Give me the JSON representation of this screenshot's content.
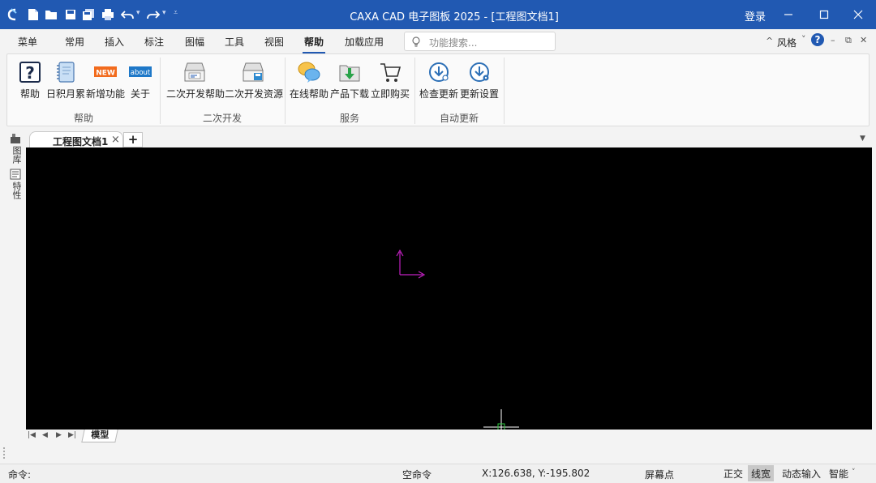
{
  "window": {
    "title": "CAXA CAD 电子图板 2025 - [工程图文档1]",
    "login_label": "登录",
    "accent_color": "#2159b2"
  },
  "quick_access": {
    "icons": [
      "new-file-icon",
      "open-file-icon",
      "save-icon",
      "save-all-icon",
      "print-icon",
      "undo-icon",
      "redo-icon",
      "customize-icon"
    ]
  },
  "menu_tabs": [
    {
      "label": "菜单"
    },
    {
      "label": "常用"
    },
    {
      "label": "插入"
    },
    {
      "label": "标注"
    },
    {
      "label": "图幅"
    },
    {
      "label": "工具"
    },
    {
      "label": "视图"
    },
    {
      "label": "帮助",
      "active": true
    },
    {
      "label": "加载应用"
    }
  ],
  "search": {
    "placeholder": "功能搜索..."
  },
  "style_switch": {
    "label": "风格"
  },
  "ribbon": {
    "groups": [
      {
        "label": "帮助",
        "buttons": [
          {
            "label": "帮助",
            "icon": "help-question-icon"
          },
          {
            "label": "日积月累",
            "icon": "notebook-icon"
          },
          {
            "label": "新增功能",
            "icon": "new-badge-icon",
            "badge": "NEW"
          },
          {
            "label": "关于",
            "icon": "about-badge-icon",
            "badge": "about"
          }
        ]
      },
      {
        "label": "二次开发",
        "buttons": [
          {
            "label": "二次开发帮助",
            "icon": "dev-help-icon"
          },
          {
            "label": "二次开发资源",
            "icon": "dev-resource-icon"
          }
        ]
      },
      {
        "label": "服务",
        "buttons": [
          {
            "label": "在线帮助",
            "icon": "online-help-icon"
          },
          {
            "label": "产品下载",
            "icon": "download-folder-icon"
          },
          {
            "label": "立即购买",
            "icon": "cart-icon"
          }
        ]
      },
      {
        "label": "自动更新",
        "buttons": [
          {
            "label": "检查更新",
            "icon": "check-update-icon"
          },
          {
            "label": "更新设置",
            "icon": "update-settings-icon"
          }
        ]
      }
    ]
  },
  "document_tabs": [
    {
      "label": "工程图文档1",
      "active": true
    }
  ],
  "side_panel": [
    {
      "label": "图库"
    },
    {
      "label": "特性"
    }
  ],
  "layout_tabs": [
    {
      "label": "模型",
      "active": true
    }
  ],
  "command": {
    "prompt": "命令:"
  },
  "status": {
    "idle_text": "空命令",
    "coords": "X:126.638, Y:-195.802",
    "snap_mode": "屏幕点",
    "toggles": [
      {
        "label": "正交",
        "on": false
      },
      {
        "label": "线宽",
        "on": true
      },
      {
        "label": "动态输入",
        "on": false
      },
      {
        "label": "智能",
        "on": false
      }
    ]
  }
}
